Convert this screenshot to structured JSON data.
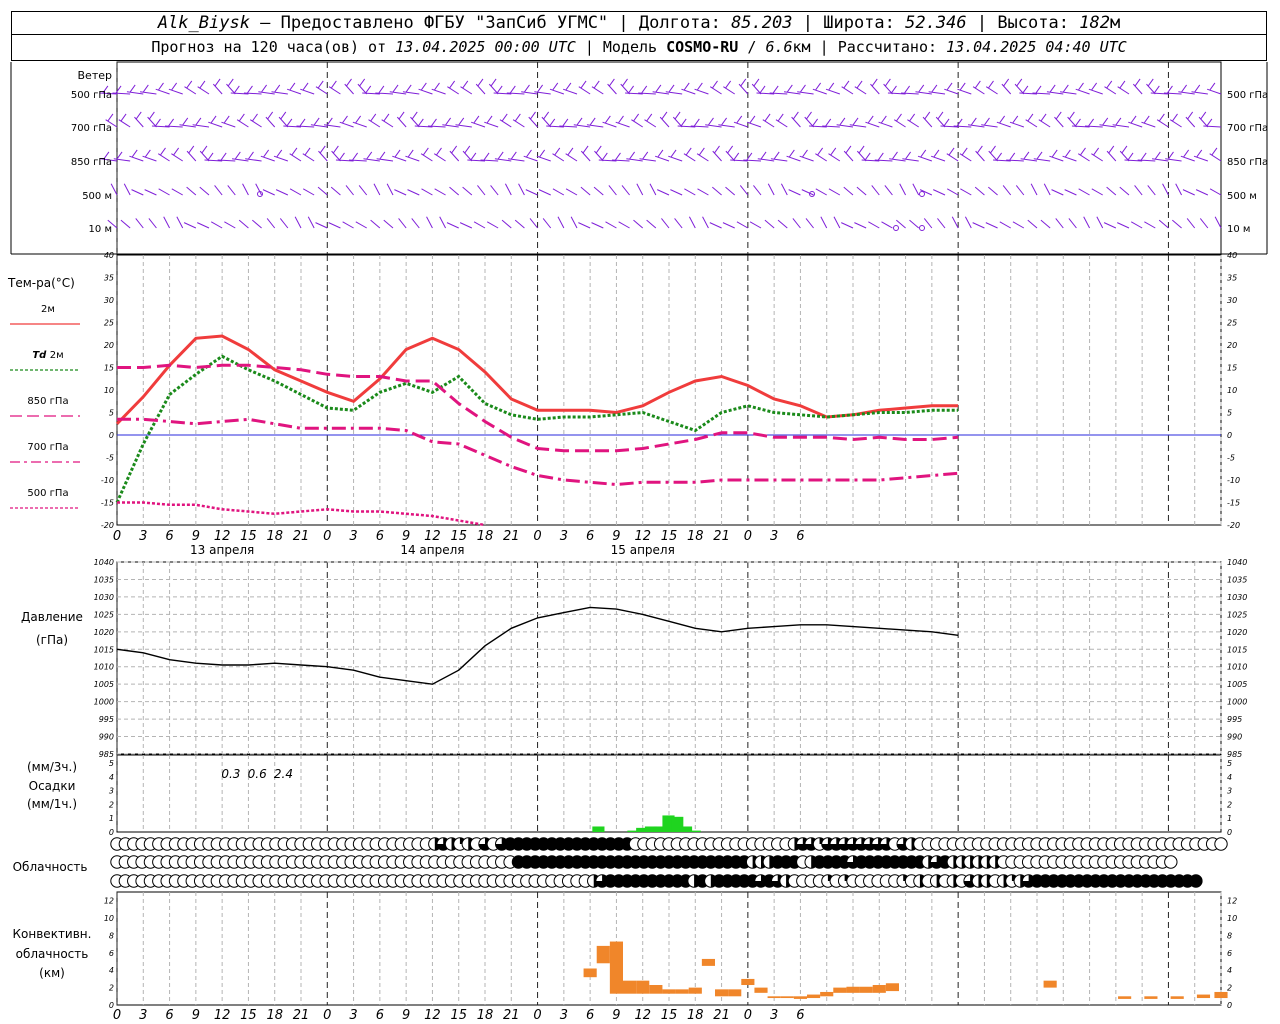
{
  "header": {
    "station": "Alk_Biysk",
    "dash": " — ",
    "provider": "Предоставлено ФГБУ \"ЗапСиб УГМС\"",
    "lon_label": "Долгота:",
    "lon_value": "85.203",
    "lat_label": "Широта:",
    "lat_value": "52.346",
    "alt_label": "Высота:",
    "alt_value": "182",
    "alt_unit": "м",
    "forecast_prefix": "Прогноз на 120 часа(ов) от",
    "forecast_start": "13.04.2025 00:00 UTC",
    "model_label": "Модель",
    "model_name": "COSMO-RU",
    "model_res": "6.6",
    "model_res_unit": "км",
    "calc_label": "Рассчитано:",
    "calc_time": "13.04.2025 04:40 UTC",
    "sep": "|"
  },
  "wind_panel": {
    "title": "Ветер",
    "levels": [
      "500 гПа",
      "700 гПа",
      "850 гПа",
      "500 м",
      "10  м"
    ],
    "color": "#7f1fd8"
  },
  "time_axis": {
    "hour_labels": [
      "0",
      "3",
      "6",
      "9",
      "12",
      "15",
      "18",
      "21",
      "0",
      "3",
      "6",
      "9",
      "12",
      "15",
      "18",
      "21",
      "0",
      "3",
      "6",
      "9",
      "12",
      "15",
      "18",
      "21",
      "0",
      "3",
      "6"
    ],
    "day_labels": [
      "13 апреля",
      "14 апреля",
      "15 апреля"
    ]
  },
  "temp_legend": {
    "title": "Тем-ра(°С)",
    "items": [
      {
        "label": "2м",
        "italic_prefix": "",
        "color": "#f03c3c"
      },
      {
        "label": "2м",
        "italic_prefix": "Td",
        "color": "#1a8a1a"
      },
      {
        "label": "850 гПа",
        "italic_prefix": "",
        "color": "#e0147f"
      },
      {
        "label": "700 гПа",
        "italic_prefix": "",
        "color": "#e0147f"
      },
      {
        "label": "500 гПа",
        "italic_prefix": "",
        "color": "#e0147f"
      }
    ]
  },
  "pressure_panel": {
    "title_line1": "Давление",
    "title_line2": "(гПа)"
  },
  "precip_panel": {
    "unit_3h": "(мм/3ч.)",
    "title": "Осадки",
    "unit_1h": "(мм/1ч.)",
    "totals": [
      {
        "text": "0.3",
        "hour": 13
      },
      {
        "text": "0.6",
        "hour": 16
      },
      {
        "text": "2.4",
        "hour": 19
      }
    ],
    "color": "#1fd41f"
  },
  "cloud_panel": {
    "title": "Облачность"
  },
  "conv_panel": {
    "title_line1": "Конвективн.",
    "title_line2": "облачность",
    "title_line3": "(км)",
    "color": "#f0862a"
  },
  "chart_data": [
    {
      "type": "line",
      "title": "Тем-ра(°С)",
      "x_hours": [
        0,
        3,
        6,
        9,
        12,
        15,
        18,
        21,
        24,
        27,
        30,
        33,
        36,
        39,
        42,
        45,
        48,
        51,
        54,
        57,
        60,
        63,
        66,
        69,
        72,
        75,
        78,
        81,
        84,
        87,
        90,
        93,
        96,
        99,
        102,
        105,
        108,
        111,
        114,
        117,
        120,
        123,
        126
      ],
      "ylim": [
        -20,
        40
      ],
      "y_ticks": [
        -20,
        -15,
        -10,
        -5,
        0,
        5,
        10,
        15,
        20,
        25,
        30,
        35,
        40
      ],
      "series": [
        {
          "name": "2м",
          "style": "solid",
          "color": "#f03c3c",
          "values": [
            2.5,
            8.5,
            15.5,
            21.5,
            22,
            19,
            14.5,
            12,
            9.5,
            7.5,
            12.5,
            19,
            21.5,
            19,
            14,
            8,
            5.5,
            5.5,
            5.5,
            5,
            6.5,
            9.5,
            12,
            13,
            11,
            8,
            6.5,
            4,
            4.5,
            5.5,
            6,
            6.5,
            6.5
          ]
        },
        {
          "name": "Td 2м",
          "style": "dotted",
          "color": "#1a8a1a",
          "values": [
            -15,
            -2,
            9,
            13.5,
            17.5,
            14.5,
            12,
            9,
            6,
            5.5,
            9.5,
            11.5,
            9.5,
            13,
            7,
            4.5,
            3.5,
            4,
            4,
            4.5,
            5,
            3,
            1,
            5,
            6.5,
            5,
            4.5,
            4,
            4.5,
            5,
            5,
            5.5,
            5.5
          ]
        },
        {
          "name": "850 гПа",
          "style": "dashed",
          "color": "#e0147f",
          "values": [
            15,
            15,
            15.5,
            15,
            15.5,
            15.5,
            15,
            14.5,
            13.5,
            13,
            13,
            12,
            12,
            7,
            3,
            -0.5,
            -3,
            -3.5,
            -3.5,
            -3.5,
            -3,
            -2,
            -1,
            0.5,
            0.5,
            -0.5,
            -0.5,
            -0.5,
            -1,
            -0.5,
            -1,
            -1,
            -0.5
          ]
        },
        {
          "name": "700 гПа",
          "style": "dashdot",
          "color": "#e0147f",
          "values": [
            3.5,
            3.5,
            3,
            2.5,
            3,
            3.5,
            2.5,
            1.5,
            1.5,
            1.5,
            1.5,
            1,
            -1.5,
            -2,
            -4.5,
            -7,
            -9,
            -10,
            -10.5,
            -11,
            -10.5,
            -10.5,
            -10.5,
            -10,
            -10,
            -10,
            -10,
            -10,
            -10,
            -10,
            -9.5,
            -9,
            -8.5
          ]
        },
        {
          "name": "500 гПа",
          "style": "dotted",
          "color": "#e0147f",
          "values": [
            -15,
            -15,
            -15.5,
            -15.5,
            -16.5,
            -17,
            -17.5,
            -17,
            -16.5,
            -17,
            -17,
            -17.5,
            -18,
            -19,
            -20
          ]
        }
      ]
    },
    {
      "type": "line",
      "title": "Давление",
      "ylabel": "(гПа)",
      "x_hours": [
        0,
        3,
        6,
        9,
        12,
        15,
        18,
        21,
        24,
        27,
        30,
        33,
        36,
        39,
        42,
        45,
        48,
        51,
        54,
        57,
        60,
        63,
        66,
        69,
        72,
        75,
        78,
        81,
        84,
        87,
        90,
        93,
        96,
        99,
        102,
        105,
        108,
        111,
        114,
        117,
        120,
        123,
        126
      ],
      "ylim": [
        985,
        1040
      ],
      "y_ticks": [
        985,
        990,
        995,
        1000,
        1005,
        1010,
        1015,
        1020,
        1025,
        1030,
        1035,
        1040
      ],
      "values": [
        1015,
        1014,
        1012,
        1011,
        1010.5,
        1010.5,
        1011,
        1010.5,
        1010,
        1009,
        1007,
        1006,
        1005,
        1009,
        1016,
        1021,
        1024,
        1025.5,
        1027,
        1026.5,
        1025,
        1023,
        1021,
        1020,
        1021,
        1021.5,
        1022,
        1022,
        1021.5,
        1021,
        1020.5,
        1020,
        1019
      ]
    },
    {
      "type": "bar",
      "title": "Осадки",
      "ylabel": "(мм/1ч.)",
      "ylim": [
        0,
        5
      ],
      "bars": [
        {
          "hour": 55,
          "value": 0.4
        },
        {
          "hour": 59,
          "value": 0.1
        },
        {
          "hour": 60,
          "value": 0.3
        },
        {
          "hour": 61,
          "value": 0.4
        },
        {
          "hour": 62,
          "value": 0.4
        },
        {
          "hour": 63,
          "value": 1.2
        },
        {
          "hour": 64,
          "value": 1.1
        },
        {
          "hour": 65,
          "value": 0.4
        },
        {
          "hour": 66,
          "value": 0.1
        }
      ]
    },
    {
      "type": "table",
      "title": "Облачность",
      "note": "Cloud cover octa fractions per hour; three rows (upper, middle, lower)",
      "rows": [
        [
          0,
          0,
          0,
          0,
          0,
          0,
          0,
          0,
          0,
          0,
          0,
          0,
          0,
          0,
          0,
          0,
          0,
          0,
          0,
          0,
          0,
          0,
          0,
          0,
          0,
          0,
          0,
          0,
          0,
          0,
          0,
          0,
          0,
          0,
          0,
          0,
          0,
          0,
          0.5,
          0.75,
          0.5,
          0.25,
          0.5,
          0,
          0.75,
          0,
          0.75,
          1,
          1,
          1,
          1,
          1,
          1,
          1,
          1,
          1,
          1,
          1,
          1,
          1,
          1,
          1,
          0,
          0,
          0,
          0,
          0,
          0,
          0,
          0,
          0,
          0,
          0,
          0,
          0,
          0,
          0,
          0,
          0,
          0,
          0,
          0.5,
          0.75,
          0.75,
          0.25,
          0.75,
          0.75,
          0.75,
          0.75,
          0.75,
          0.75,
          0.75,
          0.75,
          0,
          0.75,
          0.5,
          0,
          0,
          0,
          0,
          0,
          0,
          0,
          0,
          0,
          0,
          0,
          0,
          0,
          0,
          0,
          0,
          0,
          0,
          0,
          0,
          0,
          0,
          0,
          0,
          0,
          0,
          0,
          0,
          0,
          0,
          0,
          0,
          0,
          0,
          0,
          0,
          0
        ],
        [
          0,
          0,
          0,
          0,
          0,
          0,
          0,
          0,
          0,
          0,
          0,
          0,
          0,
          0,
          0,
          0,
          0,
          0,
          0,
          0,
          0,
          0,
          0,
          0,
          0,
          0,
          0,
          0,
          0,
          0,
          0,
          0,
          0,
          0,
          0,
          0,
          0,
          0,
          0,
          0,
          0,
          0,
          0,
          0,
          0,
          0,
          0,
          0,
          1,
          1,
          1,
          1,
          1,
          1,
          1,
          1,
          1,
          1,
          1,
          1,
          1,
          1,
          1,
          1,
          1,
          1,
          1,
          1,
          1,
          1,
          1,
          1,
          1,
          1,
          1,
          1,
          0.5,
          0.5,
          0.5,
          1,
          1,
          1,
          0,
          0.5,
          1,
          1,
          1,
          1,
          0.75,
          1,
          1,
          1,
          1,
          1,
          1,
          1,
          1,
          0.5,
          0.75,
          1,
          0.5,
          0.5,
          0.5,
          0.5,
          0.5,
          0.5,
          0,
          0,
          0,
          0,
          0,
          0,
          0,
          0,
          0,
          0,
          0,
          0,
          0,
          0,
          0,
          0,
          0,
          0,
          0,
          0,
          0
        ],
        [
          0,
          0,
          0,
          0,
          0,
          0,
          0,
          0,
          0,
          0,
          0,
          0,
          0,
          0,
          0,
          0,
          0,
          0,
          0,
          0,
          0,
          0,
          0,
          0,
          0,
          0,
          0,
          0,
          0,
          0,
          0,
          0,
          0,
          0,
          0,
          0,
          0,
          0,
          0,
          0,
          0,
          0,
          0,
          0,
          0,
          0,
          0,
          0,
          0,
          0,
          0,
          0,
          0,
          0,
          0,
          0,
          0,
          0.5,
          0.75,
          1,
          1,
          1,
          1,
          1,
          1,
          1,
          1,
          1,
          1,
          0.5,
          1,
          0.5,
          1,
          1,
          1,
          1,
          1,
          0.75,
          1,
          0.75,
          0.5,
          0,
          0,
          0,
          0,
          0.25,
          0,
          0.25,
          0,
          0,
          0,
          0,
          0,
          0,
          0.25,
          0,
          0.5,
          0,
          0.5,
          0,
          0.5,
          0,
          0.75,
          0.5,
          0.5,
          0,
          0.5,
          0.25,
          0.5,
          0.75,
          1,
          1,
          1,
          1,
          1,
          1,
          1,
          1,
          1,
          1,
          1,
          1,
          1,
          1,
          1,
          1,
          1,
          1,
          1,
          1
        ]
      ]
    },
    {
      "type": "bar",
      "title": "Конвективн. облачность",
      "ylabel": "(км)",
      "ylim": [
        0,
        13
      ],
      "y_ticks": [
        0,
        2,
        4,
        6,
        8,
        10,
        12
      ],
      "bars": [
        {
          "hour": 54,
          "base": 3.2,
          "top": 4.2
        },
        {
          "hour": 55.5,
          "base": 4.8,
          "top": 6.8
        },
        {
          "hour": 57,
          "base": 1.3,
          "top": 7.3
        },
        {
          "hour": 58.5,
          "base": 1.3,
          "top": 2.8
        },
        {
          "hour": 60,
          "base": 1.3,
          "top": 2.8
        },
        {
          "hour": 61.5,
          "base": 1.3,
          "top": 2.3
        },
        {
          "hour": 63,
          "base": 1.3,
          "top": 1.8
        },
        {
          "hour": 64.5,
          "base": 1.3,
          "top": 1.8
        },
        {
          "hour": 66,
          "base": 1.3,
          "top": 2.0
        },
        {
          "hour": 67.5,
          "base": 4.5,
          "top": 5.3
        },
        {
          "hour": 69,
          "base": 1.0,
          "top": 1.8
        },
        {
          "hour": 70.5,
          "base": 1.0,
          "top": 1.8
        },
        {
          "hour": 72,
          "base": 2.3,
          "top": 3.0
        },
        {
          "hour": 73.5,
          "base": 1.4,
          "top": 2.0
        },
        {
          "hour": 75,
          "base": 0.8,
          "top": 1.0
        },
        {
          "hour": 76.5,
          "base": 0.8,
          "top": 1.0
        },
        {
          "hour": 78,
          "base": 0.7,
          "top": 1.0
        },
        {
          "hour": 79.5,
          "base": 0.8,
          "top": 1.2
        },
        {
          "hour": 81,
          "base": 1.0,
          "top": 1.5
        },
        {
          "hour": 82.5,
          "base": 1.4,
          "top": 2.0
        },
        {
          "hour": 84,
          "base": 1.4,
          "top": 2.1
        },
        {
          "hour": 85.5,
          "base": 1.4,
          "top": 2.1
        },
        {
          "hour": 87,
          "base": 1.4,
          "top": 2.3
        },
        {
          "hour": 88.5,
          "base": 1.6,
          "top": 2.5
        },
        {
          "hour": 106.5,
          "base": 2.0,
          "top": 2.8
        },
        {
          "hour": 115,
          "base": 0.7,
          "top": 1.0
        },
        {
          "hour": 118,
          "base": 0.7,
          "top": 1.0
        },
        {
          "hour": 121,
          "base": 0.7,
          "top": 1.0
        },
        {
          "hour": 124,
          "base": 0.8,
          "top": 1.2
        },
        {
          "hour": 126,
          "base": 0.8,
          "top": 1.5
        }
      ]
    }
  ]
}
